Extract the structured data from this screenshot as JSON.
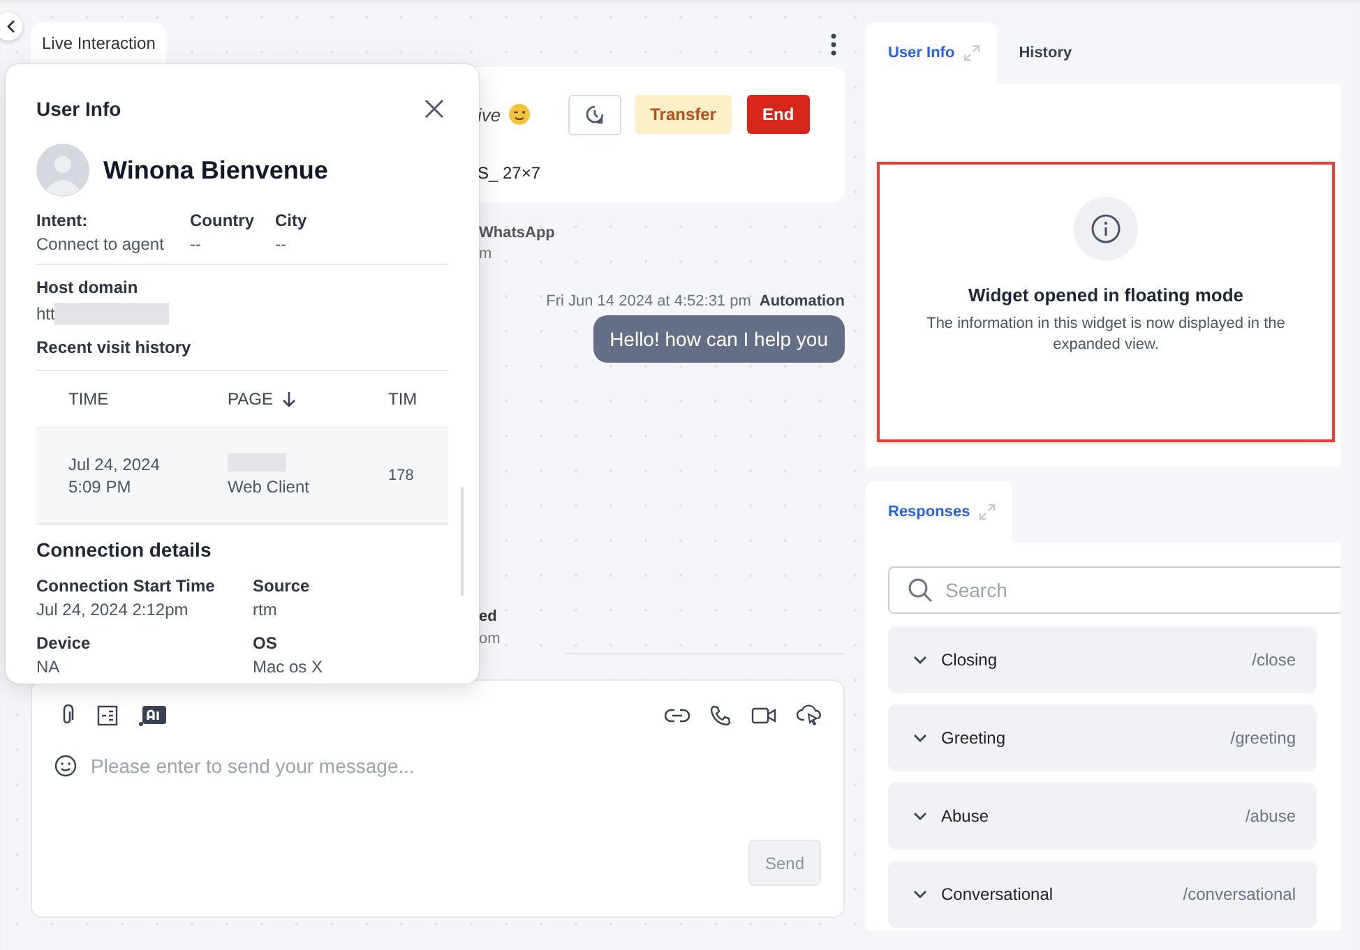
{
  "header": {
    "tab": "Live Interaction"
  },
  "chat": {
    "title_fragment": "ive",
    "subtitle_fragment": "S_ 27×7",
    "buttons": [
      {
        "label": "Transfer",
        "kind": "warning"
      },
      {
        "label": "End",
        "kind": "danger"
      }
    ],
    "channel_fragment": "WhatsApp",
    "channel_sub_fragment": "m",
    "messages": [
      {
        "timestamp": "Fri Jun 14 2024 at 4:52:31 pm",
        "sender": "Automation",
        "text": "Hello! how can I help you"
      }
    ],
    "event_fragment": "ed",
    "event_sub_fragment": "om"
  },
  "composer": {
    "placeholder": "Please enter to send your message...",
    "send": {
      "label": "Send",
      "disabled": true
    }
  },
  "user_info_popup": {
    "title": "User Info",
    "name": "Winona Bienvenue",
    "fields": [
      {
        "label": "Intent:",
        "value": "Connect to agent"
      },
      {
        "label": "Country",
        "value": "--"
      },
      {
        "label": "City",
        "value": "--"
      }
    ],
    "host_domain": {
      "label": "Host domain",
      "value": "htt"
    },
    "visit_history": {
      "title": "Recent visit history",
      "columns": [
        {
          "label": "TIME",
          "sorted": false
        },
        {
          "label": "PAGE",
          "sorted": true
        },
        {
          "label": "TIM",
          "sorted": false
        }
      ],
      "rows": [
        [
          "Jul 24, 2024 5:09 PM",
          "Web Client",
          "178"
        ]
      ]
    },
    "connection": {
      "title": "Connection details",
      "fields": [
        {
          "label": "Connection Start Time",
          "value": "Jul 24, 2024 2:12pm"
        },
        {
          "label": "Source",
          "value": "rtm"
        },
        {
          "label": "Device",
          "value": "NA"
        },
        {
          "label": "OS",
          "value": "Mac os X"
        }
      ]
    }
  },
  "side_panel": {
    "tabs": [
      {
        "label": "User Info",
        "selected": true
      },
      {
        "label": "History",
        "selected": false
      }
    ],
    "notice": {
      "title": "Widget opened in floating mode",
      "text": "The information in this widget is now displayed in the expanded view."
    }
  },
  "responses": {
    "tab": "Responses",
    "search_placeholder": "Search",
    "items": [
      {
        "name": "Closing",
        "shortcut": "/close"
      },
      {
        "name": "Greeting",
        "shortcut": "/greeting"
      },
      {
        "name": "Abuse",
        "shortcut": "/abuse"
      },
      {
        "name": "Conversational",
        "shortcut": "/conversational"
      }
    ]
  }
}
